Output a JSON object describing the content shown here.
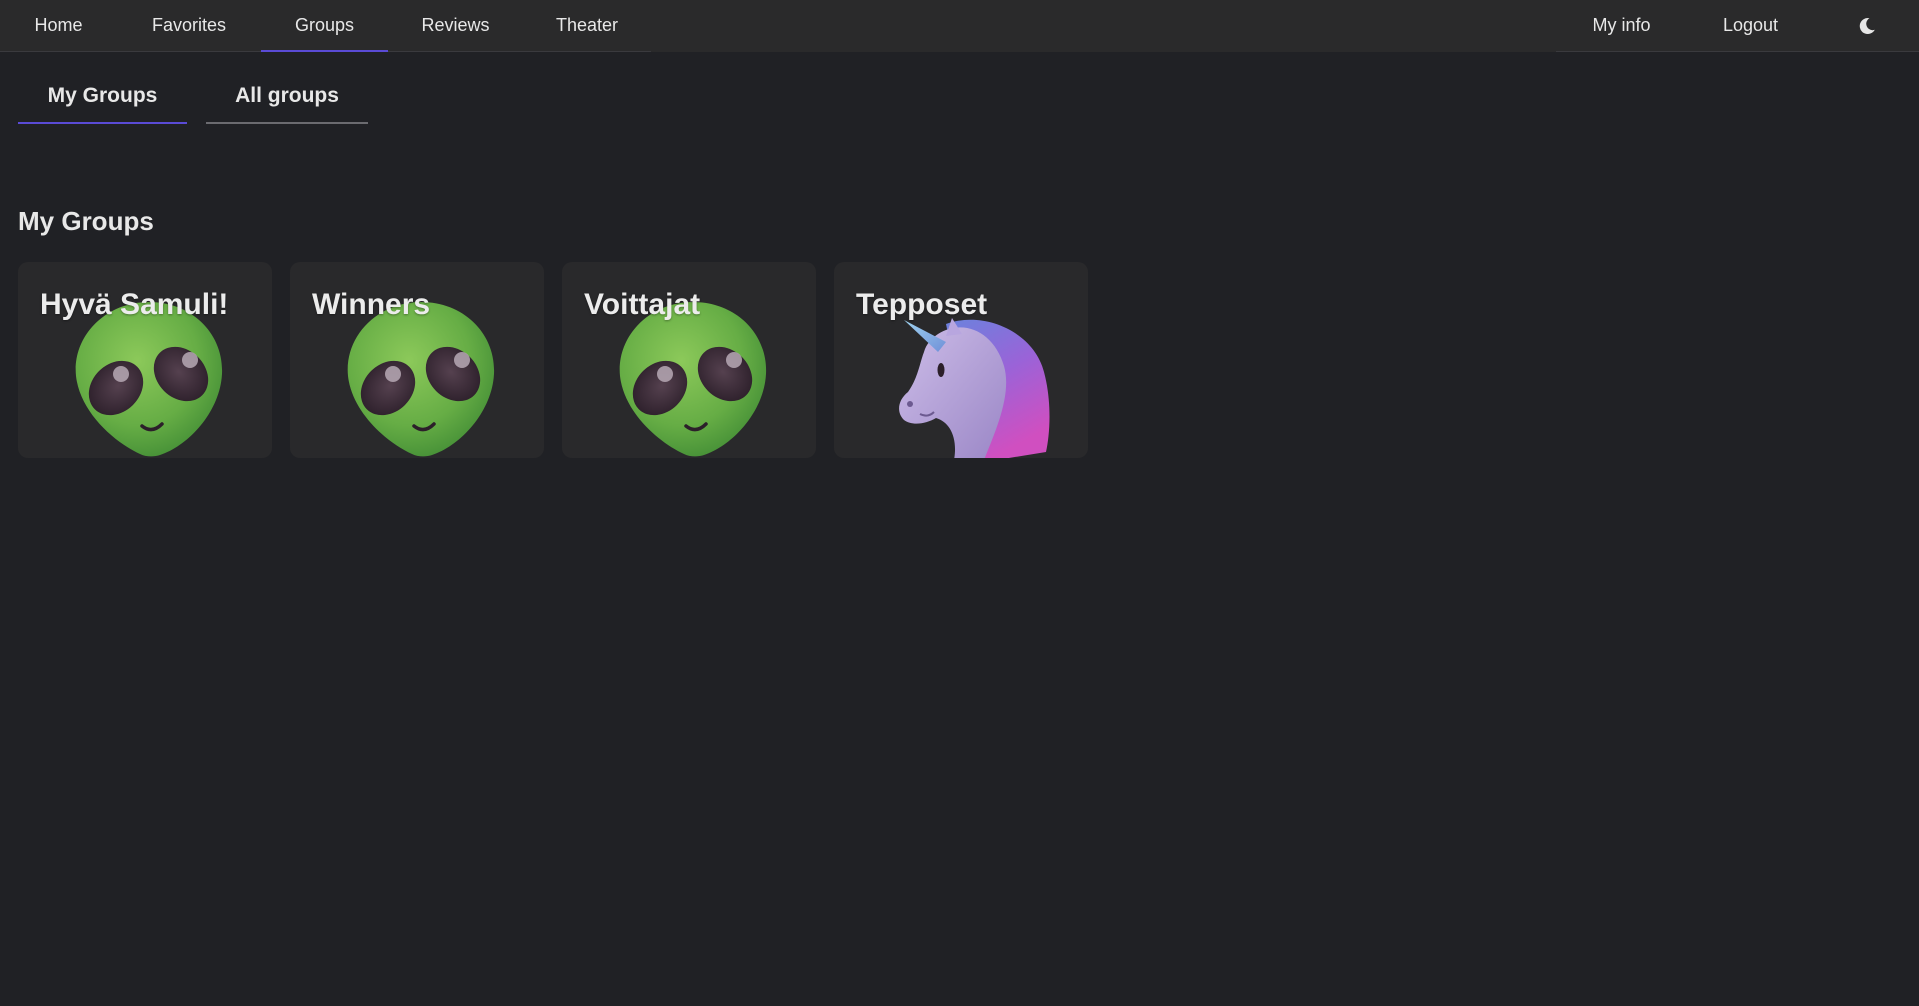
{
  "navbar": {
    "items": [
      {
        "label": "Home"
      },
      {
        "label": "Favorites"
      },
      {
        "label": "Groups",
        "active": true
      },
      {
        "label": "Reviews"
      },
      {
        "label": "Theater"
      }
    ],
    "right_items": [
      {
        "label": "My info"
      },
      {
        "label": "Logout"
      }
    ],
    "theme_icon": "moon-icon"
  },
  "subtabs": [
    {
      "label": "My Groups",
      "active": true
    },
    {
      "label": "All groups"
    }
  ],
  "section": {
    "title": "My Groups"
  },
  "groups": [
    {
      "name": "Hyvä Samuli!",
      "icon": "alien-icon"
    },
    {
      "name": "Winners",
      "icon": "alien-icon"
    },
    {
      "name": "Voittajat",
      "icon": "alien-icon"
    },
    {
      "name": "Tepposet",
      "icon": "unicorn-icon"
    }
  ],
  "colors": {
    "background": "#202125",
    "navbar": "#2a2a2b",
    "card": "#29292b",
    "accent": "#5a4bd6"
  }
}
